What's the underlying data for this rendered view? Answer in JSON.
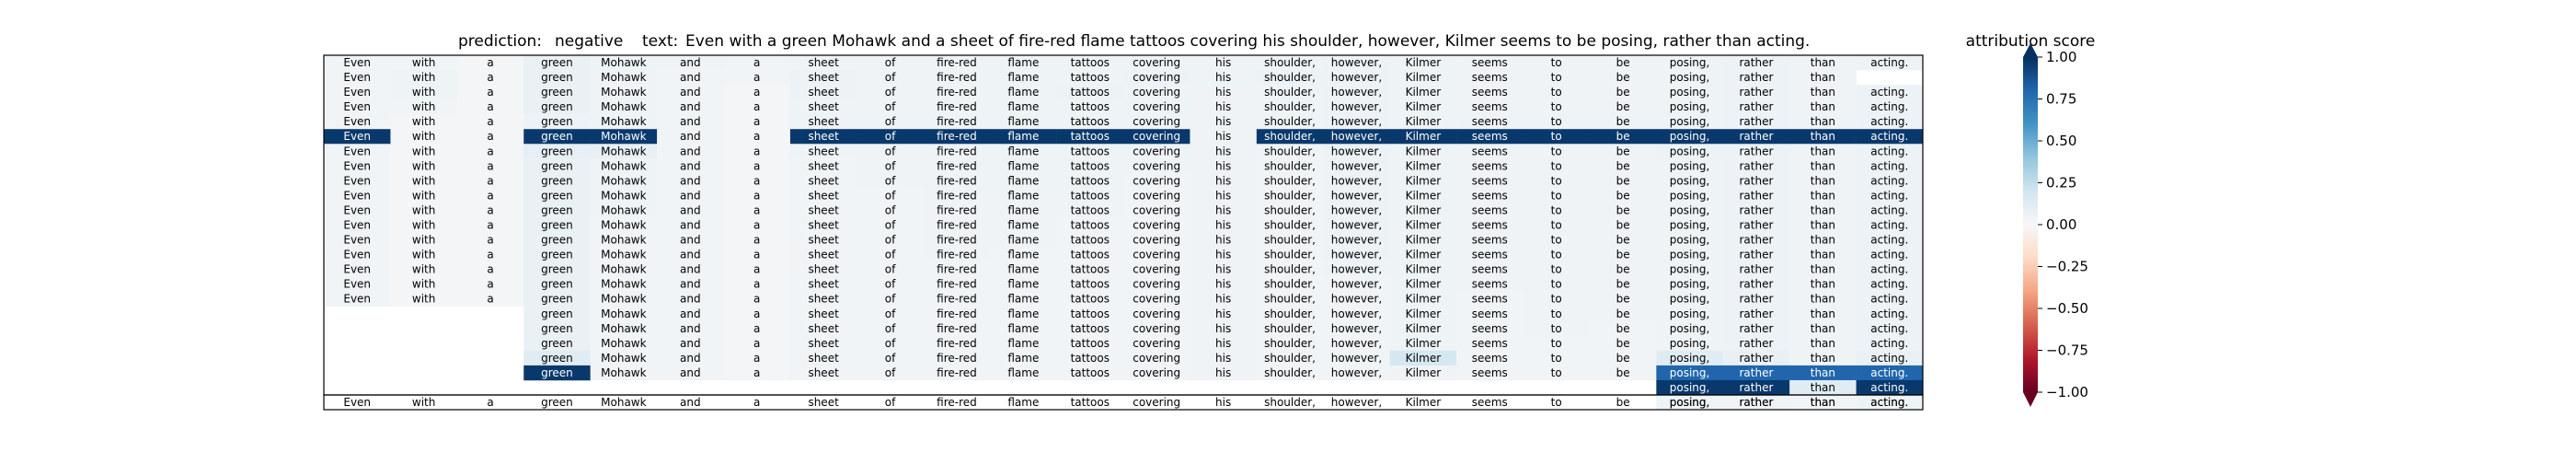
{
  "header": {
    "prediction_label": "prediction:",
    "prediction_value": "negative",
    "text_label": "text:",
    "text_value": "Even with a green Mohawk and a sheet of fire-red flame tattoos covering his shoulder, however, Kilmer seems to be posing, rather than acting."
  },
  "chart_data": {
    "type": "heatmap",
    "title": "",
    "tokens": [
      "Even",
      "with",
      "a",
      "green",
      "Mohawk",
      "and",
      "a",
      "sheet",
      "of",
      "fire-red",
      "flame",
      "tattoos",
      "covering",
      "his",
      "shoulder,",
      "however,",
      "Kilmer",
      "seems",
      "to",
      "be",
      "posing,",
      "rather",
      "than",
      "acting."
    ],
    "rows": [
      {
        "start": 0,
        "end": 23,
        "values": [
          0.03,
          0.03,
          0.02,
          0.07,
          0.05,
          0.04,
          0.03,
          0.05,
          0.04,
          0.05,
          0.05,
          0.05,
          0.05,
          0.04,
          0.05,
          0.06,
          0.05,
          0.04,
          0.04,
          0.04,
          0.05,
          0.06,
          0.04,
          0.06
        ]
      },
      {
        "start": 0,
        "end": 22,
        "values": [
          0.03,
          0.05,
          0.02,
          0.07,
          0.04,
          0.03,
          0.03,
          0.06,
          0.04,
          0.05,
          0.05,
          0.05,
          0.06,
          0.05,
          0.06,
          0.06,
          0.05,
          0.04,
          0.04,
          0.04,
          0.05,
          0.06,
          0.04
        ]
      },
      {
        "start": 0,
        "end": 23,
        "values": [
          0.03,
          0.05,
          0.02,
          0.07,
          0.04,
          0.03,
          0.02,
          0.06,
          0.04,
          0.05,
          0.05,
          0.06,
          0.05,
          0.04,
          0.05,
          0.06,
          0.05,
          0.04,
          0.04,
          0.04,
          0.05,
          0.06,
          0.04,
          0.06
        ]
      },
      {
        "start": 0,
        "end": 23,
        "values": [
          0.03,
          0.03,
          0.02,
          0.07,
          0.05,
          0.03,
          0.02,
          0.05,
          0.04,
          0.05,
          0.05,
          0.05,
          0.05,
          0.04,
          0.05,
          0.06,
          0.05,
          0.04,
          0.04,
          0.04,
          0.05,
          0.06,
          0.04,
          0.06
        ]
      },
      {
        "start": 0,
        "end": 23,
        "values": [
          0.03,
          0.02,
          0.02,
          0.06,
          0.05,
          0.03,
          0.02,
          0.05,
          0.04,
          0.05,
          0.05,
          0.05,
          0.05,
          0.04,
          0.05,
          0.06,
          0.05,
          0.04,
          0.04,
          0.04,
          0.05,
          0.06,
          0.04,
          0.06
        ]
      },
      {
        "start": 0,
        "end": 23,
        "values": [
          0.97,
          0.02,
          0.02,
          0.97,
          0.97,
          0.03,
          0.02,
          0.97,
          0.97,
          0.97,
          0.97,
          0.97,
          0.97,
          0.04,
          0.97,
          0.97,
          0.97,
          0.97,
          0.97,
          0.97,
          0.97,
          0.97,
          0.97,
          0.97
        ]
      },
      {
        "start": 0,
        "end": 23,
        "values": [
          0.03,
          0.02,
          0.02,
          0.09,
          0.08,
          0.03,
          0.02,
          0.05,
          0.04,
          0.05,
          0.05,
          0.05,
          0.05,
          0.04,
          0.03,
          0.06,
          0.05,
          0.04,
          0.04,
          0.04,
          0.06,
          0.06,
          0.04,
          0.06
        ]
      },
      {
        "start": 0,
        "end": 23,
        "values": [
          0.03,
          0.02,
          0.02,
          0.07,
          0.05,
          0.03,
          0.02,
          0.03,
          0.04,
          0.05,
          0.05,
          0.05,
          0.05,
          0.04,
          0.03,
          0.06,
          0.05,
          0.04,
          0.04,
          0.04,
          0.05,
          0.06,
          0.04,
          0.06
        ]
      },
      {
        "start": 0,
        "end": 23,
        "values": [
          0.03,
          0.02,
          0.02,
          0.07,
          0.05,
          0.03,
          0.02,
          0.03,
          0.04,
          0.05,
          0.05,
          0.05,
          0.03,
          0.04,
          0.03,
          0.06,
          0.05,
          0.04,
          0.04,
          0.04,
          0.05,
          0.06,
          0.04,
          0.06
        ]
      },
      {
        "start": 0,
        "end": 23,
        "values": [
          0.03,
          0.02,
          0.02,
          0.07,
          0.05,
          0.03,
          0.02,
          0.03,
          0.03,
          0.05,
          0.05,
          0.05,
          0.03,
          0.04,
          0.03,
          0.06,
          0.05,
          0.04,
          0.04,
          0.04,
          0.05,
          0.06,
          0.04,
          0.06
        ]
      },
      {
        "start": 0,
        "end": 23,
        "values": [
          0.03,
          0.02,
          0.02,
          0.07,
          0.05,
          0.03,
          0.02,
          0.03,
          0.03,
          0.04,
          0.04,
          0.04,
          0.03,
          0.04,
          0.03,
          0.06,
          0.05,
          0.04,
          0.04,
          0.04,
          0.05,
          0.06,
          0.04,
          0.06
        ]
      },
      {
        "start": 0,
        "end": 23,
        "values": [
          0.03,
          0.02,
          0.02,
          0.07,
          0.03,
          0.03,
          0.02,
          0.03,
          0.03,
          0.04,
          0.04,
          0.03,
          0.03,
          0.04,
          0.03,
          0.06,
          0.05,
          0.04,
          0.04,
          0.04,
          0.05,
          0.06,
          0.04,
          0.06
        ]
      },
      {
        "start": 0,
        "end": 23,
        "values": [
          0.03,
          0.02,
          0.02,
          0.07,
          0.03,
          0.03,
          0.02,
          0.03,
          0.03,
          0.04,
          0.04,
          0.03,
          0.03,
          0.04,
          0.03,
          0.06,
          0.05,
          0.04,
          0.04,
          0.04,
          0.05,
          0.06,
          0.04,
          0.06
        ]
      },
      {
        "start": 0,
        "end": 23,
        "values": [
          0.03,
          0.02,
          0.02,
          0.07,
          0.03,
          0.03,
          0.02,
          0.03,
          0.03,
          0.04,
          0.03,
          0.03,
          0.03,
          0.04,
          0.03,
          0.06,
          0.05,
          0.04,
          0.04,
          0.04,
          0.05,
          0.06,
          0.04,
          0.06
        ]
      },
      {
        "start": 0,
        "end": 23,
        "values": [
          0.03,
          0.02,
          0.02,
          0.07,
          0.03,
          0.03,
          0.02,
          0.03,
          0.03,
          0.03,
          0.03,
          0.03,
          0.03,
          0.04,
          0.03,
          0.05,
          0.05,
          0.04,
          0.04,
          0.04,
          0.05,
          0.06,
          0.04,
          0.06
        ]
      },
      {
        "start": 0,
        "end": 23,
        "values": [
          0.03,
          0.02,
          0.02,
          0.07,
          0.03,
          0.03,
          0.02,
          0.03,
          0.03,
          0.03,
          0.03,
          0.03,
          0.03,
          0.04,
          0.03,
          0.03,
          0.05,
          0.04,
          0.04,
          0.04,
          0.05,
          0.06,
          0.04,
          0.06
        ]
      },
      {
        "start": 0,
        "end": 23,
        "values": [
          0.03,
          0.02,
          0.02,
          0.07,
          0.03,
          0.03,
          0.02,
          0.03,
          0.03,
          0.03,
          0.03,
          0.03,
          0.03,
          0.04,
          0.03,
          0.03,
          0.05,
          0.03,
          0.04,
          0.04,
          0.05,
          0.06,
          0.04,
          0.06
        ]
      },
      {
        "start": 3,
        "end": 23,
        "values": [
          0.07,
          0.03,
          0.03,
          0.02,
          0.03,
          0.03,
          0.03,
          0.03,
          0.03,
          0.03,
          0.04,
          0.03,
          0.03,
          0.05,
          0.03,
          0.04,
          0.04,
          0.05,
          0.06,
          0.04,
          0.06
        ]
      },
      {
        "start": 3,
        "end": 23,
        "values": [
          0.07,
          0.03,
          0.03,
          0.02,
          0.03,
          0.03,
          0.03,
          0.03,
          0.03,
          0.03,
          0.04,
          0.03,
          0.03,
          0.05,
          0.03,
          0.04,
          0.03,
          0.05,
          0.06,
          0.04,
          0.06
        ]
      },
      {
        "start": 3,
        "end": 23,
        "values": [
          0.07,
          0.03,
          0.03,
          0.02,
          0.03,
          0.03,
          0.03,
          0.03,
          0.03,
          0.03,
          0.04,
          0.03,
          0.03,
          0.05,
          0.03,
          0.03,
          0.03,
          0.05,
          0.06,
          0.04,
          0.06
        ]
      },
      {
        "start": 3,
        "end": 23,
        "values": [
          0.12,
          0.03,
          0.03,
          0.02,
          0.03,
          0.03,
          0.03,
          0.03,
          0.03,
          0.03,
          0.04,
          0.03,
          0.03,
          0.18,
          0.03,
          0.03,
          0.03,
          0.12,
          0.08,
          0.05,
          0.07
        ]
      },
      {
        "start": 3,
        "end": 23,
        "values": [
          0.97,
          0.03,
          0.03,
          0.02,
          0.03,
          0.03,
          0.03,
          0.03,
          0.03,
          0.03,
          0.04,
          0.03,
          0.03,
          0.04,
          0.03,
          0.03,
          0.03,
          0.8,
          0.8,
          0.8,
          0.8
        ]
      },
      {
        "start": 20,
        "end": 23,
        "values": [
          0.97,
          0.97,
          0.12,
          0.97
        ]
      },
      {
        "start": 20,
        "end": 23,
        "values": [
          0.05,
          0.04,
          0.03,
          0.05
        ]
      }
    ],
    "final_row": [
      "Even",
      "with",
      "a",
      "green",
      "Mohawk",
      "and",
      "a",
      "sheet",
      "of",
      "fire-red",
      "flame",
      "tattoos",
      "covering",
      "his",
      "shoulder,",
      "however,",
      "Kilmer",
      "seems",
      "to",
      "be",
      "posing,",
      "rather",
      "than",
      "acting."
    ],
    "colorbar": {
      "label": "attribution score",
      "ticks": [
        "1.00",
        "0.75",
        "0.50",
        "0.25",
        "0.00",
        "−0.25",
        "−0.50",
        "−0.75",
        "−1.00"
      ],
      "range": [
        -1,
        1
      ],
      "colormap": "RdBu",
      "extend": "both"
    },
    "colors": {
      "positive_strong": "#053061",
      "positive_mid": "#2166ac",
      "neutral": "#f7f7f7",
      "negative_mid": "#d6604d",
      "negative_strong": "#67001f"
    }
  }
}
